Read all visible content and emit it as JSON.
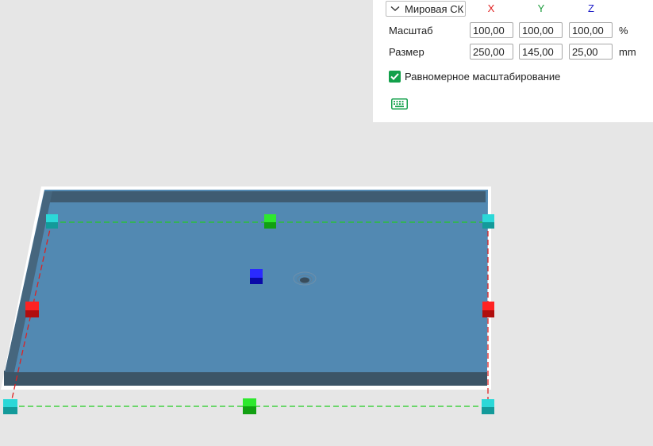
{
  "transform_panel": {
    "coord_system": "Мировая СК",
    "axes": [
      {
        "label": "X",
        "color": "#e02020"
      },
      {
        "label": "Y",
        "color": "#1a9a3a"
      },
      {
        "label": "Z",
        "color": "#2020c8"
      }
    ],
    "scale": {
      "label": "Масштаб",
      "x": "100,00",
      "y": "100,00",
      "z": "100,00",
      "unit": "%"
    },
    "size": {
      "label": "Размер",
      "x": "250,00",
      "y": "145,00",
      "z": "25,00",
      "unit": "mm"
    },
    "uniform_scaling": {
      "label": "Равномерное масштабирование",
      "checked": true
    },
    "keyboard_icon": "keyboard-icon"
  },
  "colors": {
    "plate_top": "#5289b2",
    "plate_side": "#3e5a70",
    "gizmo_x": "#e01818",
    "gizmo_y": "#19b519",
    "gizmo_z": "#1010e0",
    "gizmo_corner": "#19c8c8",
    "checkbox": "#12a04a",
    "background": "#e6e6e6"
  }
}
